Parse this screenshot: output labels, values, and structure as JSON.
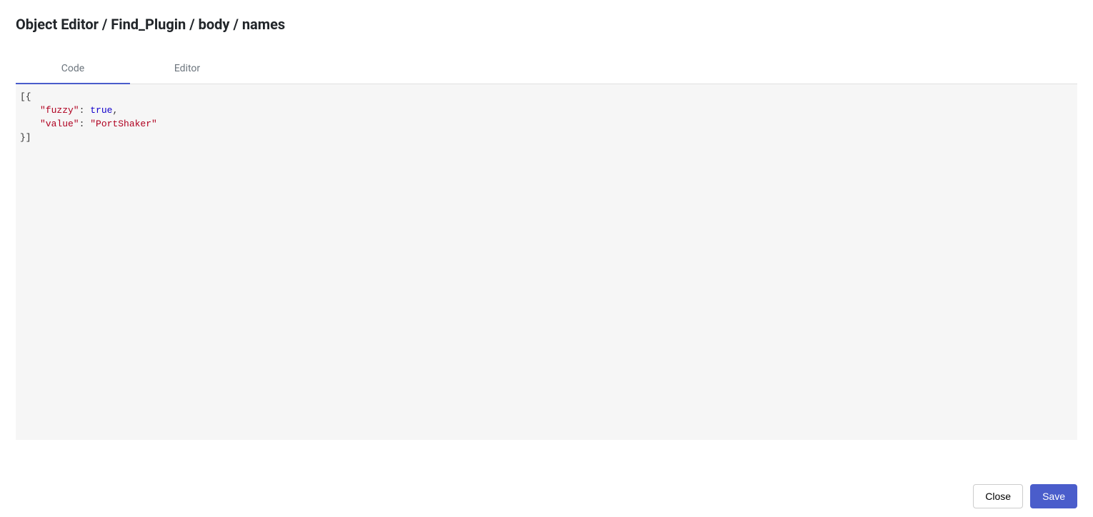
{
  "header": {
    "breadcrumb": "Object Editor / Find_Plugin / body / names"
  },
  "tabs": [
    {
      "label": "Code",
      "active": true
    },
    {
      "label": "Editor",
      "active": false
    }
  ],
  "code": {
    "lines": [
      {
        "prefix": "[{",
        "content": ""
      },
      {
        "prefix": "",
        "key": "\"fuzzy\"",
        "sep": ": ",
        "value": "true",
        "value_type": "bool",
        "suffix": ","
      },
      {
        "prefix": "",
        "key": "\"value\"",
        "sep": ": ",
        "value": "\"PortShaker\"",
        "value_type": "str",
        "suffix": ""
      },
      {
        "prefix": "}]",
        "content": ""
      }
    ]
  },
  "footer": {
    "close_label": "Close",
    "save_label": "Save"
  }
}
